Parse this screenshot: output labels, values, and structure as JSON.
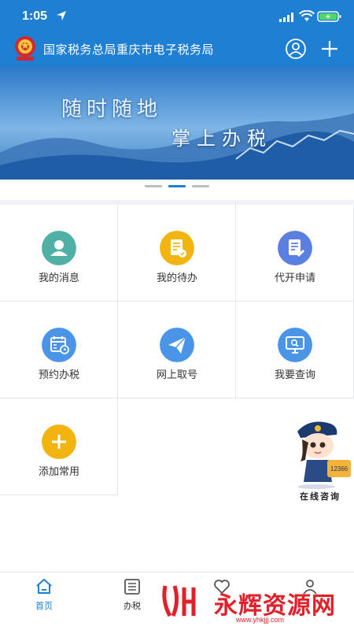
{
  "status_bar": {
    "time": "1:05"
  },
  "header": {
    "title": "国家税务总局重庆市电子税务局"
  },
  "banner": {
    "line1": "随时随地",
    "line2": "掌上办税"
  },
  "grid": [
    {
      "label": "我的消息",
      "icon": "user-icon",
      "color": "#4fb0a5"
    },
    {
      "label": "我的待办",
      "icon": "document-icon",
      "color": "#f2b40f"
    },
    {
      "label": "代开申请",
      "icon": "document-icon",
      "color": "#5b7fe0"
    },
    {
      "label": "预约办税",
      "icon": "calendar-icon",
      "color": "#4a95e8"
    },
    {
      "label": "网上取号",
      "icon": "paper-plane-icon",
      "color": "#4a95e8"
    },
    {
      "label": "我要查询",
      "icon": "monitor-icon",
      "color": "#4a95e8"
    },
    {
      "label": "添加常用",
      "icon": "plus-icon",
      "color": "#f2b40f"
    }
  ],
  "consult": {
    "label": "在线咨询",
    "badge": "12366"
  },
  "tabs": [
    {
      "label": "首页",
      "icon": "home-icon",
      "active": true
    },
    {
      "label": "办税",
      "icon": "list-icon",
      "active": false
    },
    {
      "label": "",
      "icon": "heart-icon",
      "active": false
    },
    {
      "label": "",
      "icon": "person-icon",
      "active": false
    }
  ],
  "watermark": {
    "text": "永辉资源网",
    "url": "www.yhkjjj.com"
  },
  "colors": {
    "primary": "#1f7fd3",
    "watermark": "#e2202a"
  }
}
